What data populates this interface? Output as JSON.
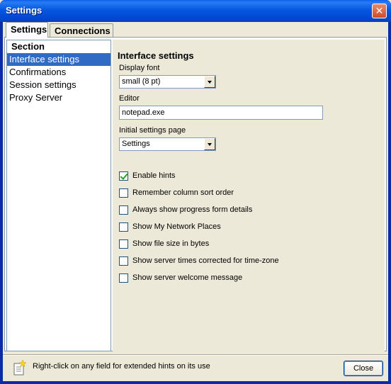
{
  "window": {
    "title": "Settings"
  },
  "tabs": [
    {
      "label": "Settings",
      "active": true
    },
    {
      "label": "Connections",
      "active": false
    }
  ],
  "section_list": {
    "header": "Section",
    "items": [
      {
        "label": "Interface settings",
        "selected": true
      },
      {
        "label": "Confirmations",
        "selected": false
      },
      {
        "label": "Session settings",
        "selected": false
      },
      {
        "label": "Proxy Server",
        "selected": false
      }
    ]
  },
  "interface": {
    "heading": "Interface settings",
    "display_font": {
      "label": "Display font",
      "value": "small (8 pt)"
    },
    "editor": {
      "label": "Editor",
      "value": "notepad.exe"
    },
    "initial_page": {
      "label": "Initial settings page",
      "value": "Settings"
    },
    "options": [
      {
        "label": "Enable hints",
        "checked": true
      },
      {
        "label": "Remember column sort order",
        "checked": false
      },
      {
        "label": "Always show progress form details",
        "checked": false
      },
      {
        "label": "Show My Network Places",
        "checked": false
      },
      {
        "label": "Show file size in bytes",
        "checked": false
      },
      {
        "label": "Show server times corrected for time-zone",
        "checked": false
      },
      {
        "label": "Show server welcome message",
        "checked": false
      }
    ]
  },
  "footer": {
    "hint": "Right-click on any field for extended hints on its use",
    "close_label": "Close",
    "hint_icon": "document-sparkle-icon"
  },
  "colors": {
    "title_bar": "#0458e0",
    "selection": "#316ac5",
    "check": "#21a121"
  }
}
